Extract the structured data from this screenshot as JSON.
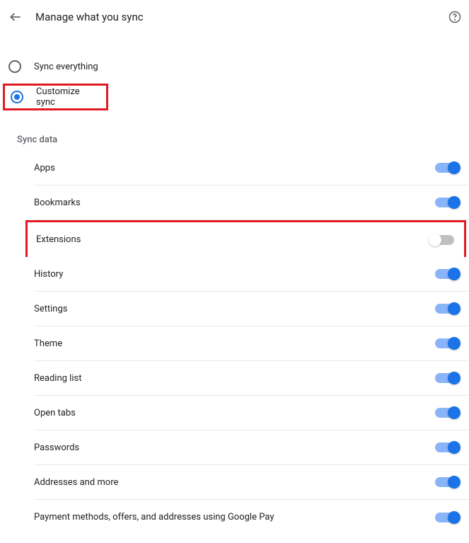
{
  "header": {
    "title": "Manage what you sync"
  },
  "radio": {
    "sync_everything": "Sync everything",
    "customize_sync": "Customize sync"
  },
  "section": {
    "title": "Sync data"
  },
  "items": {
    "apps": "Apps",
    "bookmarks": "Bookmarks",
    "extensions": "Extensions",
    "history": "History",
    "settings": "Settings",
    "theme": "Theme",
    "reading_list": "Reading list",
    "open_tabs": "Open tabs",
    "passwords": "Passwords",
    "addresses": "Addresses and more",
    "payment": "Payment methods, offers, and addresses using Google Pay"
  }
}
